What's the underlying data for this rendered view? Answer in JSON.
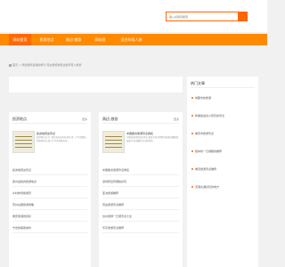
{
  "search": {
    "placeholder": "输入关键词搜索"
  },
  "nav": [
    {
      "label": "网站首页"
    },
    {
      "label": "投资地点"
    },
    {
      "label": "周边 旅游"
    },
    {
      "label": "网站资"
    },
    {
      "label": "适合年轻人旅"
    }
  ],
  "breadcrumb": "首页 > 伴随游所选择的旅行 周边游旅游周边游年轻人旅游",
  "panels": {
    "left": {
      "title": "投资地点",
      "more": "更多",
      "feature_title": "投资地周边景点",
      "feature_desc": "投资地点位于广西壮族自治区桂林市,是一个非常著名的旅游景点,吸引了众多游客前来...",
      "items": [
        "投资地周边景点",
        "贵州最热的旅游地点",
        "乡村休闲旅游景",
        "苏州古镇旅游攻略",
        "重庆旅游的目标",
        "宁德的美丽城市"
      ]
    },
    "mid": {
      "title": "周边 旅游",
      "more": "更多",
      "feature_title": "中国各省旅游景点排名",
      "feature_desc": "中国各省旅游景点排名,旅游业是中国经济发展的重要组成部分,各省都有自己独特的...",
      "items": [
        "中国各省旅游景点排名",
        "深圳附近有哪些好玩",
        "亚洲旅游推荐",
        "周边旅游景点推荐",
        "台州旅游一日游景点大全",
        "乐东旅游景点推荐"
      ]
    },
    "right": {
      "title": "热门文章",
      "items": [
        "成都市的旅游",
        "新疆最适合小孩玩的景点",
        "重庆市旅游景点",
        "桂林市一日游路线推荐",
        "重庆旅游景点推荐",
        "无锡太湖好玩的地方"
      ]
    }
  },
  "colors": {
    "accent": "#ff8a00",
    "accent_dark": "#ff6600"
  }
}
